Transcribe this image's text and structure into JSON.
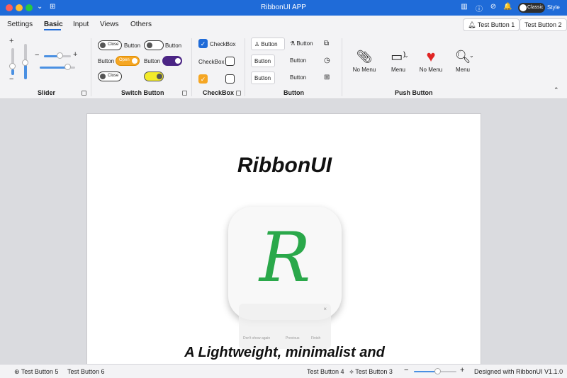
{
  "window": {
    "title": "RibbonUI APP",
    "style_toggle": "Classic",
    "style_label": "Style",
    "title_icons": [
      "map-icon",
      "info-icon",
      "no-pin-icon",
      "bell-icon",
      "contrast-icon"
    ]
  },
  "tabs": [
    {
      "label": "Settings"
    },
    {
      "label": "Basic"
    },
    {
      "label": "Input"
    },
    {
      "label": "Views"
    },
    {
      "label": "Others"
    }
  ],
  "top_buttons": {
    "test1": "Test Button 1",
    "test2": "Test Button 2"
  },
  "groups": {
    "slider": {
      "label": "Slider",
      "vertical_values": [
        0.15,
        0.4
      ],
      "horizontal_values": [
        0.55,
        0.75
      ]
    },
    "switch": {
      "label": "Switch Button",
      "close": "Close",
      "open": "Open",
      "button": "Button"
    },
    "checkbox": {
      "label": "CheckBox",
      "checkbox_text": "CheckBox"
    },
    "button": {
      "label": "Button",
      "button_text": "Button"
    },
    "push": {
      "label": "Push Button",
      "items": [
        "No Menu",
        "Menu",
        "No Menu",
        "Menu"
      ]
    }
  },
  "document": {
    "title": "RibbonUI",
    "subtitle": "A Lightweight, minimalist and",
    "icon_letter": "R",
    "dialog": {
      "close": "×",
      "dont_show": "Don't show again",
      "previous": "Previous",
      "finish": "Finish"
    }
  },
  "statusbar": {
    "left": [
      "Test Button 5",
      "Test Button 6"
    ],
    "right": [
      "Test Button 4",
      "Test Button 3"
    ],
    "zoom_value": 0.55,
    "designed": "Designed with RibbonUI V1.1.0"
  }
}
